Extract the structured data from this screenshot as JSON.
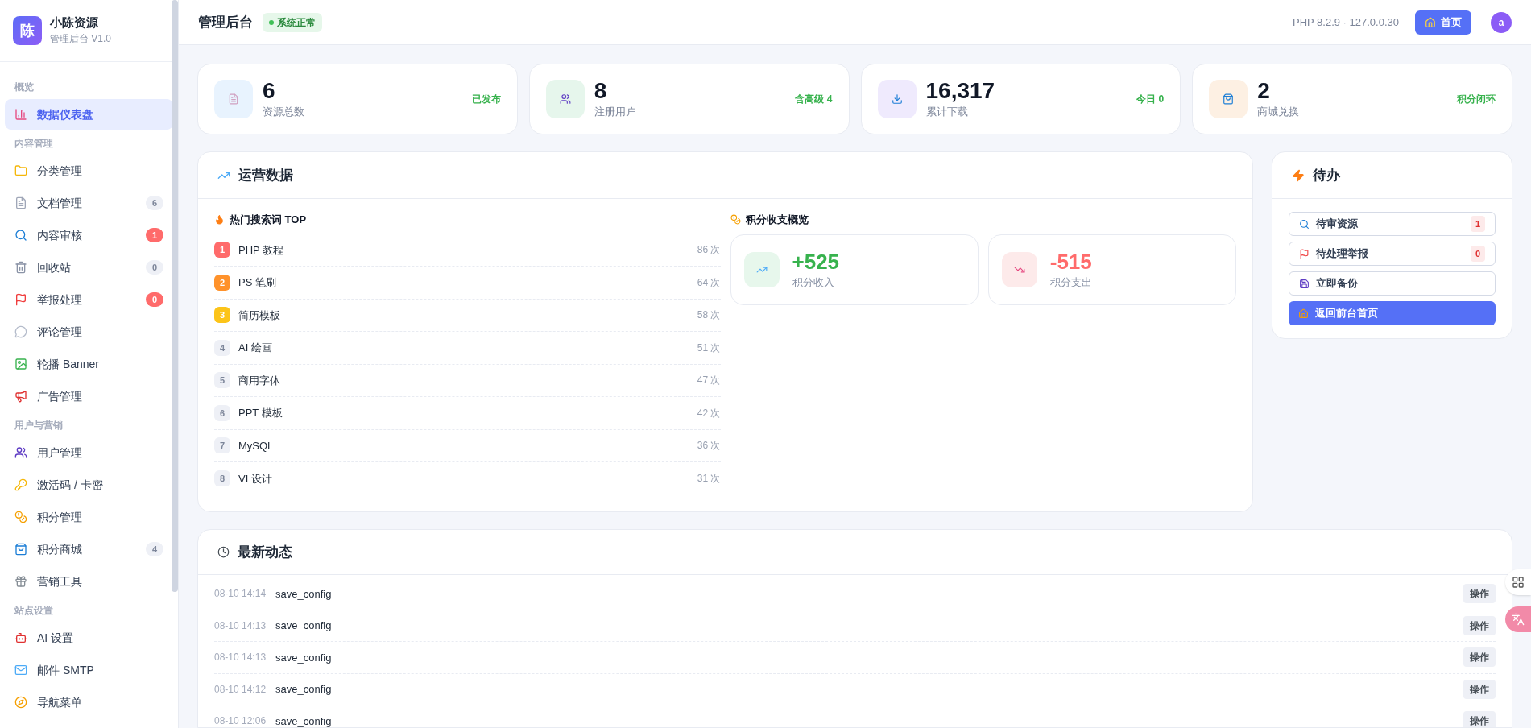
{
  "brand": {
    "logo": "陈",
    "name": "小陈资源",
    "subtitle": "管理后台 V1.0"
  },
  "sidebar": {
    "sections": [
      {
        "title": "概览",
        "items": [
          {
            "label": "数据仪表盘",
            "selected": true
          }
        ]
      },
      {
        "title": "内容管理",
        "items": [
          {
            "label": "分类管理",
            "selected": false
          },
          {
            "label": "文档管理",
            "selected": false,
            "badge": {
              "text": "6",
              "alert": false
            }
          },
          {
            "label": "内容审核",
            "selected": false,
            "badge": {
              "text": "1",
              "alert": true
            }
          },
          {
            "label": "回收站",
            "selected": false,
            "badge": {
              "text": "0",
              "alert": false
            }
          },
          {
            "label": "举报处理",
            "selected": false,
            "badge": {
              "text": "0",
              "alert": true
            }
          },
          {
            "label": "评论管理",
            "selected": false
          },
          {
            "label": "轮播 Banner",
            "selected": false
          },
          {
            "label": "广告管理",
            "selected": false
          }
        ]
      },
      {
        "title": "用户与营销",
        "items": [
          {
            "label": "用户管理",
            "selected": false
          },
          {
            "label": "激活码 / 卡密",
            "selected": false
          },
          {
            "label": "积分管理",
            "selected": false
          },
          {
            "label": "积分商城",
            "selected": false,
            "badge": {
              "text": "4",
              "alert": false
            }
          },
          {
            "label": "营销工具",
            "selected": false
          }
        ]
      },
      {
        "title": "站点设置",
        "items": [
          {
            "label": "AI 设置",
            "selected": false
          },
          {
            "label": "邮件 SMTP",
            "selected": false
          },
          {
            "label": "导航菜单",
            "selected": false
          }
        ]
      }
    ]
  },
  "header": {
    "title": "管理后台",
    "status": "系统正常",
    "server": "PHP 8.2.9 · 127.0.0.30",
    "home_button": "首页",
    "avatar": "a"
  },
  "stats": [
    {
      "value": "6",
      "label": "资源总数",
      "note": "已发布",
      "color": "#e8f3fe"
    },
    {
      "value": "8",
      "label": "注册用户",
      "note": "含高级 4",
      "color": "#e6f6ec"
    },
    {
      "value": "16,317",
      "label": "累计下载",
      "note": "今日 0",
      "color": "#efeafd"
    },
    {
      "value": "2",
      "label": "商城兑换",
      "note": "积分闭环",
      "color": "#fdf0e3"
    }
  ],
  "operations": {
    "title": "运营数据",
    "keywords_title": "热门搜索词 TOP",
    "keywords": [
      {
        "rank": "1",
        "term": "PHP 教程",
        "count": "86 次",
        "top": true,
        "color": "#ff6b6b"
      },
      {
        "rank": "2",
        "term": "PS 笔刷",
        "count": "64 次",
        "top": true,
        "color": "#ff922b"
      },
      {
        "rank": "3",
        "term": "简历模板",
        "count": "58 次",
        "top": true,
        "color": "#fcc419"
      },
      {
        "rank": "4",
        "term": "AI 绘画",
        "count": "51 次",
        "top": false,
        "color": "#eef0f6"
      },
      {
        "rank": "5",
        "term": "商用字体",
        "count": "47 次",
        "top": false,
        "color": "#eef0f6"
      },
      {
        "rank": "6",
        "term": "PPT 模板",
        "count": "42 次",
        "top": false,
        "color": "#eef0f6"
      },
      {
        "rank": "7",
        "term": "MySQL",
        "count": "36 次",
        "top": false,
        "color": "#eef0f6"
      },
      {
        "rank": "8",
        "term": "VI 设计",
        "count": "31 次",
        "top": false,
        "color": "#eef0f6"
      }
    ],
    "points_title": "积分收支概览",
    "points": [
      {
        "kind": "income",
        "value": "+525",
        "label": "积分收入"
      },
      {
        "kind": "expense",
        "value": "-515",
        "label": "积分支出"
      }
    ]
  },
  "todo": {
    "title": "待办",
    "items": [
      {
        "kind": "outline",
        "label": "待审资源",
        "badge": "1"
      },
      {
        "kind": "outline",
        "label": "待处理举报",
        "badge": "0"
      },
      {
        "kind": "outline",
        "label": "立即备份"
      },
      {
        "kind": "primary",
        "label": "返回前台首页"
      }
    ]
  },
  "activity": {
    "title": "最新动态",
    "rows": [
      {
        "time": "08-10 14:14",
        "action": "save_config",
        "button": "操作"
      },
      {
        "time": "08-10 14:13",
        "action": "save_config",
        "button": "操作"
      },
      {
        "time": "08-10 14:13",
        "action": "save_config",
        "button": "操作"
      },
      {
        "time": "08-10 14:12",
        "action": "save_config",
        "button": "操作"
      },
      {
        "time": "08-10 12:06",
        "action": "save_config",
        "button": "操作"
      }
    ]
  }
}
